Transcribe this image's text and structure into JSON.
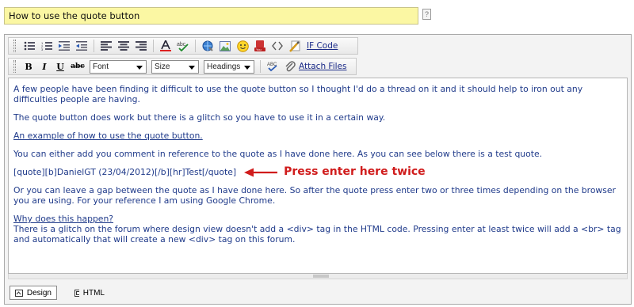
{
  "title_field": {
    "value": "How to use the quote button",
    "help": "?"
  },
  "toolbar1": {
    "icons": [
      "bullet-list-icon",
      "numbered-list-icon",
      "indent-icon",
      "outdent-icon",
      "align-left-icon",
      "align-center-icon",
      "align-right-icon",
      "font-color-icon",
      "spellcheck-icon",
      "link-icon",
      "image-icon",
      "smiley-icon",
      "youtube-icon",
      "code-icon",
      "clean-icon"
    ],
    "if_code_label": "IF Code"
  },
  "toolbar2": {
    "bold": "B",
    "italic": "I",
    "underline": "U",
    "strike": "abc",
    "font_select": "Font",
    "size_select": "Size",
    "headings_select": "Headings",
    "attach_label": "Attach Files"
  },
  "content": {
    "p1": "A few people have been finding it difficult to use the quote button so I thought I'd do a thread on it and it should help to iron out any difficulties people are having.",
    "p2": "The quote button does work but there is a glitch so you have to use it in a certain way.",
    "p3": "An example of how to use the quote button.",
    "p4": "You can either add you comment in reference to the quote as I have done here. As you can see below there is a test quote.",
    "quote_line": "[quote][b]DanielGT (23/04/2012)[/b][hr]Test[/quote]",
    "annotation": "Press enter here twice",
    "p5": "Or you can leave a gap between the quote as I have done here. So after the quote press enter two or three times depending on the browser you are using. For your reference I am using Google Chrome.",
    "p6_heading": "Why does this happen?",
    "p6": "There is a glitch on the forum where design view doesn't add a <div> tag in the HTML code. Pressing enter at least twice will add a <br> tag and automatically that will create a new <div> tag on this forum."
  },
  "modes": {
    "design": "Design",
    "html": "HTML"
  },
  "colors": {
    "title_bg": "#fbf7a3",
    "text": "#1f3a8a",
    "annotation": "#d01c1c"
  }
}
